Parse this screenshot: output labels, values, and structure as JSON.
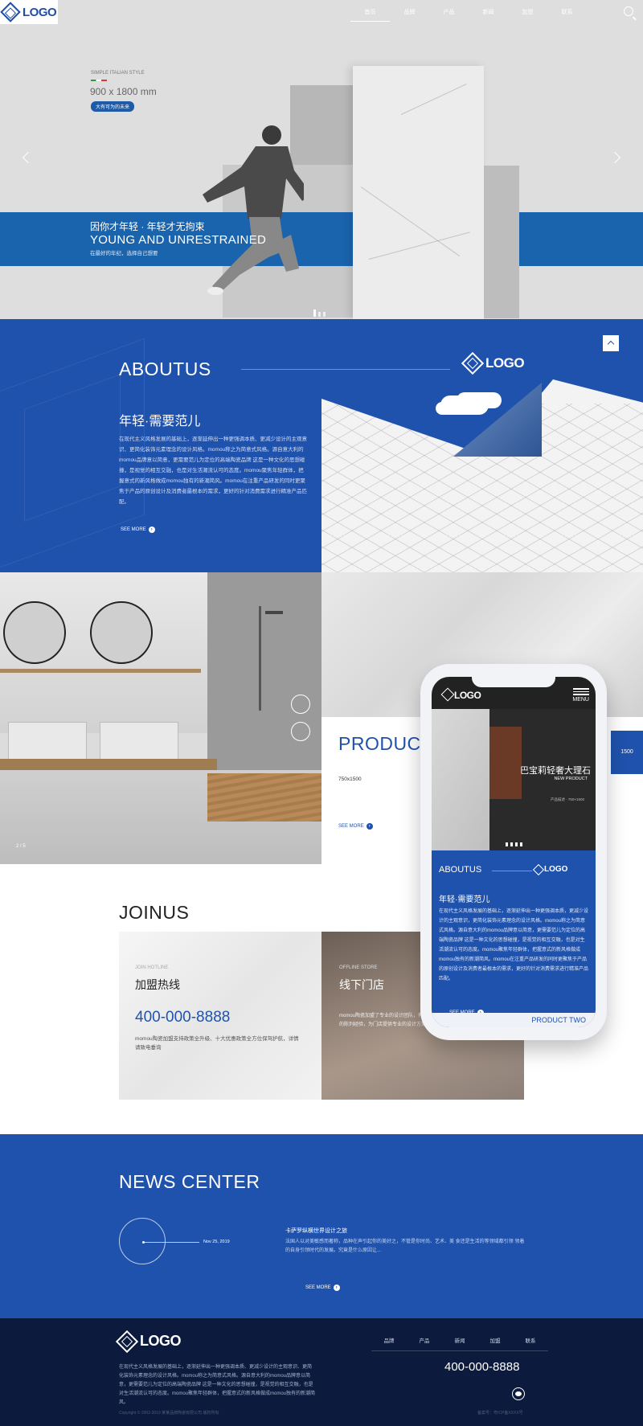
{
  "header": {
    "logo": "LOGO",
    "nav": [
      "首页",
      "品牌",
      "产品",
      "新闻",
      "加盟",
      "联系"
    ]
  },
  "hero": {
    "style_label": "SIMPLE ITALIAN STYLE",
    "size": "900 x 1800 mm",
    "pill": "大有可为的未来",
    "headline_cn": "因你才年轻 · 年轻才无拘束",
    "headline_en": "YOUNG AND UNRESTRAINED",
    "sub": "在最好的年纪，选择自己想要"
  },
  "about": {
    "title": "ABOUTUS",
    "logo": "LOGO",
    "subtitle": "年轻·需要范儿",
    "text": "在现代主义风格发展的基础上，逐渐延伸出一种更强调本质、更减少设计的主观意识、更简化装饰元素理念的设计风格。momou称之为简意式风格。源自意大利的momou品牌意以简意，更需要范儿为定位的高端陶瓷品牌 这是一种文化的思想碰撞，是视觉的相互交融，也是对生活潮流认可的态度。momou聚焦年轻群体，把握意式的新风格做成momou独有的新潮简风。momou在注重产品研发的同时更聚焦于产品的原创设计及消费者最根本的需求，更好的针对消费需求进行精准产品匹配。",
    "more": "SEE MORE"
  },
  "product": {
    "page": "2 / 5",
    "title": "PRODUC",
    "size": "750x1500",
    "more": "SEE MORE",
    "side_tab": "1500"
  },
  "phone": {
    "logo": "LOGO",
    "menu": "MENU",
    "hero_cn": "巴宝莉轻奢大理石",
    "hero_en": "NEW PRODUCT",
    "hero_small": "产品描述 · 750×1500",
    "about_title": "ABOUTUS",
    "about_logo": "LOGO",
    "subtitle": "年轻·需要范儿",
    "text": "在现代主义风格发展的基础上，逐渐延伸出一种更强调本质，更减少设计的主观意识，更简化装饰元素理念的设计风格。momou称之为简意式风格。源自意大利的momou品牌意以简意，更需要范儿为定位的高端陶瓷品牌 这是一种文化的思想碰撞，是视觉的相互交融，也是对生活潮流认可的态度。momou聚焦年轻群体，把握意式的新风格做成momou独有的新潮简风。momou在注重产品研发的同时更聚焦于产品的原创设计及消费者最根本的需求，更好的针对消费需求进行精准产品匹配。",
    "more": "SEE MORE",
    "bottom": "PRODUCT TWO"
  },
  "join": {
    "title": "JOINUS",
    "hotline_en": "JOIN HOTLINE",
    "hotline_cn": "加盟热线",
    "phone": "400-000-8888",
    "desc": "momou陶瓷加盟支持政策全升级、十大优惠政策全方位保驾护航，详情请致电垂询",
    "store_en": "OFFLINE STORE",
    "store_cn": "线下门店",
    "store_desc": "momou陶瓷加盟了专业的设计团队，有丰富的陈列经验，为门店提供专业的设计方案。"
  },
  "news": {
    "title": "NEWS CENTER",
    "date": "Nov 25, 2019",
    "headline": "卡萨罗纵横世界设计之旅",
    "text": "法国人以对美敏感而著称，品种在声引起你的美好之，不管是你时尚、艺术、美 食还是生活的等领域都引领 领着的自身引领时代的发展。究竟是什么原因让...",
    "more": "SEE MORE"
  },
  "footer": {
    "logo": "LOGO",
    "text": "在现代主义风格发展的基础上，逐渐延伸出一种更强调本质、更减少设计的主观意识、更简化装饰元素理念的设计风格。momou称之为简意式风格。源自意大利的momou品牌意以简意，更需要范儿为定位的高端陶瓷品牌 这是一种文化的思想碰撞，是视觉的相互交融，也是对生活潮流认可的态度。momou聚焦年轻群体，把握意式的新风格做成momou独有的新潮简风。",
    "nav": [
      "品牌",
      "产品",
      "新闻",
      "加盟",
      "联系"
    ],
    "phone": "400-000-8888",
    "copyright": "Copyright © 2002-2019 某某品牌陶瓷有限公司 版权所有",
    "icp": "备案号：粤ICP备XXXX号"
  }
}
